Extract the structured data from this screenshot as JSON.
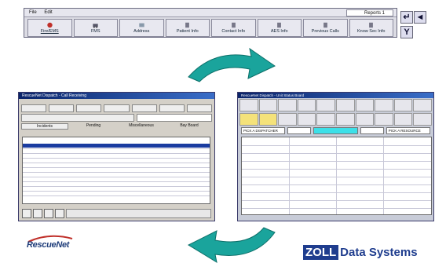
{
  "toolbar": {
    "menu": [
      "File",
      "Edit"
    ],
    "reports_label": "Reports 1",
    "buttons": [
      {
        "label": "Fire/EMS",
        "icon": "fire-emblem-icon"
      },
      {
        "label": "FMS",
        "icon": "ambulance-icon"
      },
      {
        "label": "Address",
        "icon": "address-icon"
      },
      {
        "label": "Patient Info",
        "icon": "patient-icon"
      },
      {
        "label": "Contact Info",
        "icon": "contact-icon"
      },
      {
        "label": "AES Info",
        "icon": "info-icon"
      },
      {
        "label": "Previous Calls",
        "icon": "calls-icon"
      },
      {
        "label": "Know Sec Info",
        "icon": "security-icon"
      }
    ],
    "side_buttons": [
      "↵",
      "◄",
      "Y"
    ]
  },
  "left_window": {
    "title": "RescueNet Dispatch - Call Receiving",
    "tabs": [
      "Incidents",
      "Pending",
      "Miscellaneous",
      "Bay Board"
    ]
  },
  "right_window": {
    "title": "RescueNet Dispatch - Unit Status Board",
    "field_pick": "PICK A DISPATCHER",
    "field_pick2": "PICK A RESOURCE"
  },
  "logos": {
    "rescuenet": "RescueNet",
    "zoll_box": "ZOLL",
    "zoll_text": "Data Systems"
  },
  "colors": {
    "arrow": "#1aa49c",
    "zoll_blue": "#1f3d8e",
    "title_bar": "#0a246a"
  }
}
